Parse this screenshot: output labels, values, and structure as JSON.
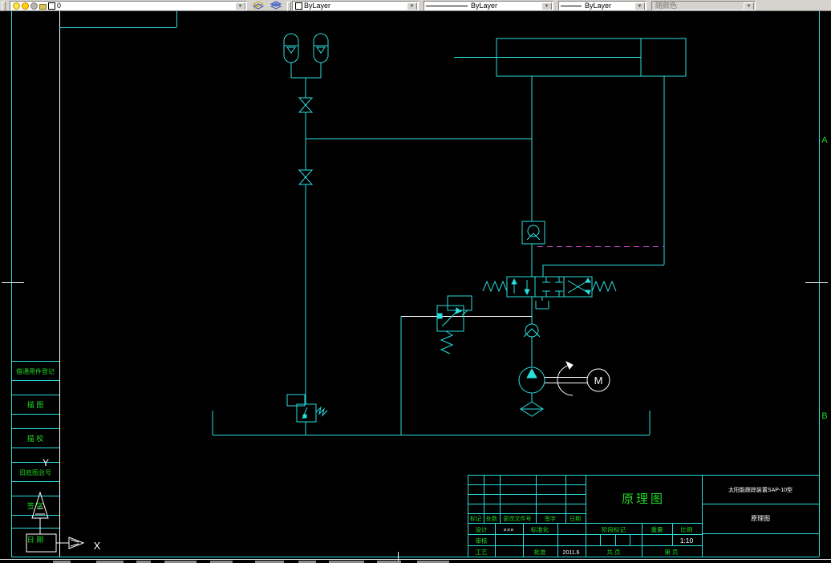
{
  "toolbar": {
    "layer_name": "0",
    "color_value": "ByLayer",
    "linetype_value": "ByLayer",
    "lineweight_value": "ByLayer",
    "plotstyle_value": "随颜色"
  },
  "canvas": {
    "zone_a": "A",
    "zone_b": "B",
    "motor": "M",
    "ucs_x": "X",
    "ucs_y": "Y"
  },
  "left_table": {
    "r1": "借通用件登记",
    "r2": "描 图",
    "r3": "描 校",
    "r4": "旧底图总号",
    "r5": "签 字",
    "r6": "日 期"
  },
  "tb": {
    "rev_mark": "标记",
    "rev_count": "处数",
    "rev_doc": "更改文件号",
    "rev_sign": "签字",
    "rev_date": "日期",
    "title": "原理图",
    "design": "设计",
    "design_name": "×××",
    "std": "标准化",
    "check": "审核",
    "craft": "工艺",
    "approve": "批准",
    "date_val": "2011.6",
    "stage": "阶段标记",
    "weight": "重量",
    "scale_label": "比例",
    "scale_val": "1:10",
    "total_label": "共 页",
    "page_label": "第 页",
    "right_top": "太阳能跟踪装置SAP-10型",
    "right_mid": "原理图"
  },
  "colors": {
    "line_cyan": "#2adede",
    "text_green": "#22d622",
    "pilot_magenta": "#cc44cc",
    "white": "#ffffff"
  }
}
